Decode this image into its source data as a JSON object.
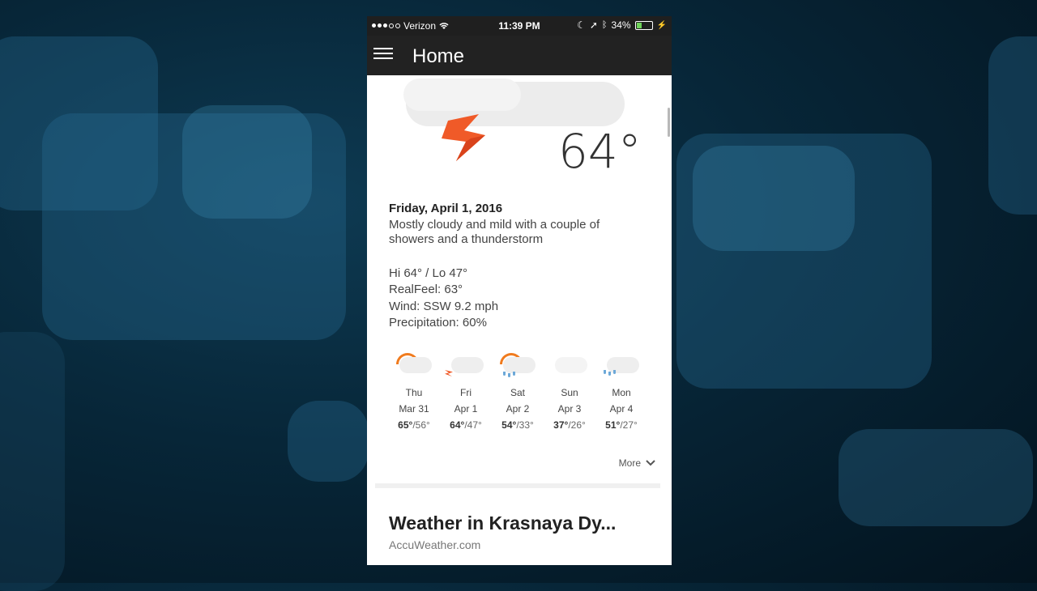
{
  "status_bar": {
    "carrier": "Verizon",
    "time": "11:39 PM",
    "battery": "34%",
    "battery_level": 0.34
  },
  "app_bar": {
    "title": "Home",
    "menu_icon": "hamburger-menu-icon"
  },
  "current": {
    "temperature": "64°",
    "date": "Friday, April 1, 2016",
    "description": "Mostly cloudy and mild with a couple of showers and a thunderstorm",
    "hilo": "Hi 64° / Lo 47°",
    "realfeel": "RealFeel: 63°",
    "wind": "Wind: SSW 9.2 mph",
    "precipitation": "Precipitation: 60%"
  },
  "forecast": [
    {
      "day": "Thu",
      "date": "Mar 31",
      "hi": "65°",
      "lo": "/56°",
      "icon": "partly-sunny-cloud-icon"
    },
    {
      "day": "Fri",
      "date": "Apr 1",
      "hi": "64°",
      "lo": "/47°",
      "icon": "thunderstorm-cloud-icon"
    },
    {
      "day": "Sat",
      "date": "Apr 2",
      "hi": "54°",
      "lo": "/33°",
      "icon": "sun-showers-icon"
    },
    {
      "day": "Sun",
      "date": "Apr 3",
      "hi": "37°",
      "lo": "/26°",
      "icon": "cloudy-icon"
    },
    {
      "day": "Mon",
      "date": "Apr 4",
      "hi": "51°",
      "lo": "/27°",
      "icon": "showers-icon"
    }
  ],
  "more_label": "More",
  "card": {
    "title": "Weather in Krasnaya Dy...",
    "source": "AccuWeather.com"
  },
  "colors": {
    "accent_orange": "#f05a28",
    "sun_orange": "#f07b1e",
    "appbar": "#222222"
  }
}
